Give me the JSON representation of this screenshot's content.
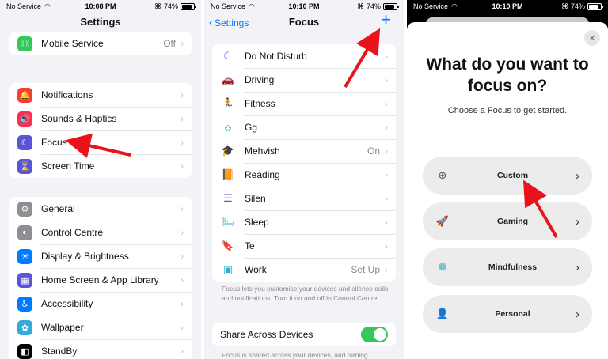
{
  "settings": {
    "status": {
      "carrier": "No Service",
      "time": "10:08 PM",
      "battery": "74%",
      "battery_level": 0.74
    },
    "title": "Settings",
    "group1": [
      {
        "label": "Mobile Service",
        "value": "Off",
        "icon": "antenna-icon",
        "color": "#34c759",
        "glyph": "((·))"
      }
    ],
    "group2": [
      {
        "label": "Notifications",
        "icon": "bell-icon",
        "color": "#ff3b30",
        "glyph": "🔔"
      },
      {
        "label": "Sounds & Haptics",
        "icon": "speaker-icon",
        "color": "#ff2d55",
        "glyph": "🔊"
      },
      {
        "label": "Focus",
        "icon": "moon-icon",
        "color": "#5856d6",
        "glyph": "☾"
      },
      {
        "label": "Screen Time",
        "icon": "hourglass-icon",
        "color": "#5856d6",
        "glyph": "⌛"
      }
    ],
    "group3": [
      {
        "label": "General",
        "icon": "gear-icon",
        "color": "#8e8e93",
        "glyph": "⚙"
      },
      {
        "label": "Control Centre",
        "icon": "switches-icon",
        "color": "#8e8e93",
        "glyph": "◐"
      },
      {
        "label": "Display & Brightness",
        "icon": "sun-icon",
        "color": "#007aff",
        "glyph": "☀"
      },
      {
        "label": "Home Screen & App Library",
        "icon": "grid-icon",
        "color": "#5856d6",
        "glyph": "▦"
      },
      {
        "label": "Accessibility",
        "icon": "accessibility-icon",
        "color": "#007aff",
        "glyph": "♿"
      },
      {
        "label": "Wallpaper",
        "icon": "flower-icon",
        "color": "#34aadc",
        "glyph": "✿"
      },
      {
        "label": "StandBy",
        "icon": "standby-icon",
        "color": "#000000",
        "glyph": "◧"
      }
    ]
  },
  "focus": {
    "status": {
      "carrier": "No Service",
      "time": "10:10 PM",
      "battery": "74%",
      "battery_level": 0.74
    },
    "back_label": "Settings",
    "title": "Focus",
    "add_label": "+",
    "items": [
      {
        "label": "Do Not Disturb",
        "icon": "moon-icon",
        "color": "#5856d6",
        "glyph": "☾"
      },
      {
        "label": "Driving",
        "icon": "car-icon",
        "color": "#007aff",
        "glyph": "🚗"
      },
      {
        "label": "Fitness",
        "icon": "running-icon",
        "color": "#34c759",
        "glyph": "🏃"
      },
      {
        "label": "Gg",
        "icon": "smiley-icon",
        "color": "#34c759",
        "glyph": "☺"
      },
      {
        "label": "Mehvish",
        "value": "On",
        "icon": "graduation-cap-icon",
        "color": "#ff2d55",
        "glyph": "🎓"
      },
      {
        "label": "Reading",
        "icon": "book-icon",
        "color": "#ff9500",
        "glyph": "📙"
      },
      {
        "label": "Silen",
        "icon": "list-icon",
        "color": "#5856d6",
        "glyph": "☰"
      },
      {
        "label": "Sleep",
        "icon": "bed-icon",
        "color": "#30b0c7",
        "glyph": "🛏"
      },
      {
        "label": "Te",
        "icon": "bookmark-icon",
        "color": "#5856d6",
        "glyph": "🔖"
      },
      {
        "label": "Work",
        "value": "Set Up",
        "icon": "id-badge-icon",
        "color": "#30b0c7",
        "glyph": "▣"
      }
    ],
    "footnote": "Focus lets you customise your devices and silence calls and notifications. Turn it on and off in Control Centre.",
    "share": {
      "label": "Share Across Devices",
      "on": true
    },
    "share_footnote": "Focus is shared across your devices, and turning"
  },
  "picker": {
    "status": {
      "carrier": "No Service",
      "time": "10:10 PM",
      "battery": "74%",
      "battery_level": 0.74
    },
    "close_label": "✕",
    "title": "What do you want to focus on?",
    "subtitle": "Choose a Focus to get started.",
    "options": [
      {
        "label": "Custom",
        "icon": "plus-circle-icon",
        "color": "#555555",
        "glyph": "⊕"
      },
      {
        "label": "Gaming",
        "icon": "rocket-icon",
        "color": "#007aff",
        "glyph": "🚀"
      },
      {
        "label": "Mindfulness",
        "icon": "flower-icon",
        "color": "#30b0c7",
        "glyph": "❁"
      },
      {
        "label": "Personal",
        "icon": "person-icon",
        "color": "#af52de",
        "glyph": "👤"
      }
    ]
  }
}
